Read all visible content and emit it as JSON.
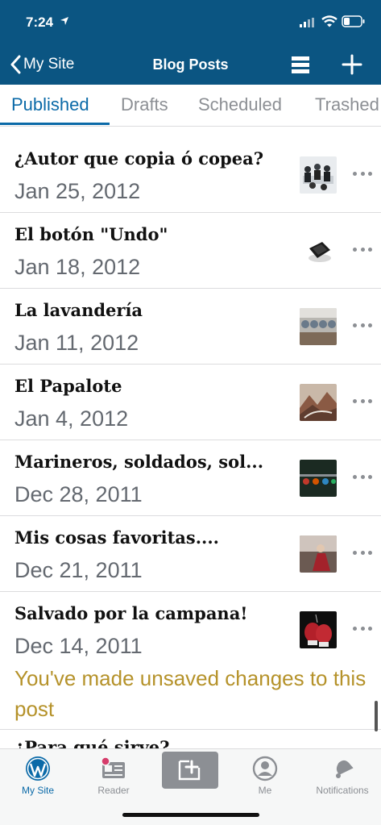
{
  "status_bar": {
    "time": "7:24"
  },
  "nav": {
    "back_label": "My Site",
    "title": "Blog Posts"
  },
  "tabs": [
    {
      "label": "Published",
      "active": true
    },
    {
      "label": "Drafts",
      "active": false
    },
    {
      "label": "Scheduled",
      "active": false
    },
    {
      "label": "Trashed",
      "active": false
    }
  ],
  "posts": [
    {
      "title": "¿Autor que copia ó copea?",
      "date": "Jan 25, 2012",
      "thumb": "meeting"
    },
    {
      "title": "El botón \"Undo\"",
      "date": "Jan 18, 2012",
      "thumb": "key"
    },
    {
      "title": "La lavandería",
      "date": "Jan 11, 2012",
      "thumb": "laundry"
    },
    {
      "title": "El Papalote",
      "date": "Jan 4, 2012",
      "thumb": "mountains"
    },
    {
      "title": "Marineros, soldados, sol...",
      "date": "Dec 28, 2011",
      "thumb": "foosball"
    },
    {
      "title": "Mis cosas favoritas....",
      "date": "Dec 21, 2011",
      "thumb": "figure"
    },
    {
      "title": "Salvado por la campana!",
      "date": "Dec 14, 2011",
      "thumb": "boxing-gloves"
    }
  ],
  "unsaved_notice": "You've made unsaved changes to this post",
  "partial_post_title": "¿Para qué sirve?",
  "tab_bar": [
    {
      "label": "My Site",
      "icon": "wordpress-icon",
      "active": true
    },
    {
      "label": "Reader",
      "icon": "reader-icon",
      "active": false
    },
    {
      "label": "",
      "icon": "new-post-icon",
      "active": false
    },
    {
      "label": "Me",
      "icon": "me-icon",
      "active": false
    },
    {
      "label": "Notifications",
      "icon": "bell-icon",
      "active": false
    }
  ],
  "colors": {
    "header": "#0b5582",
    "accent": "#0b6aa8",
    "notice": "#b5922a",
    "badge": "#d63c6b"
  }
}
